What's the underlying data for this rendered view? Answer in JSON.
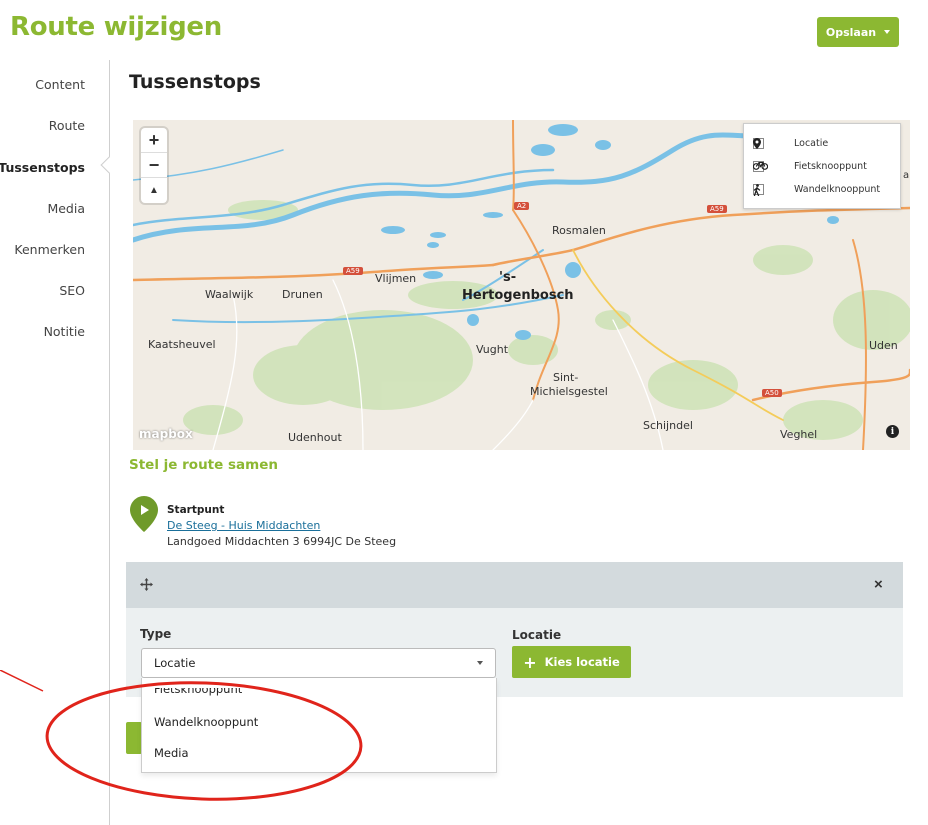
{
  "header": {
    "title": "Route wijzigen",
    "save_label": "Opslaan"
  },
  "sidebar": {
    "items": [
      {
        "label": "Content",
        "active": false
      },
      {
        "label": "Route",
        "active": false
      },
      {
        "label": "Tussenstops",
        "active": true
      },
      {
        "label": "Media",
        "active": false
      },
      {
        "label": "Kenmerken",
        "active": false
      },
      {
        "label": "SEO",
        "active": false
      },
      {
        "label": "Notitie",
        "active": false
      }
    ]
  },
  "main": {
    "section_title": "Tussenstops",
    "map": {
      "zoom_in": "+",
      "zoom_out": "−",
      "compass": "▲",
      "legend": [
        {
          "label": "Locatie",
          "icon": "location-pin-icon",
          "checked": false
        },
        {
          "label": "Fietsknooppunt",
          "icon": "bicycle-icon",
          "checked": false
        },
        {
          "label": "Wandelknooppunt",
          "icon": "walking-icon",
          "checked": false
        }
      ],
      "places": {
        "waalwijk": "Waalwijk",
        "drunen": "Drunen",
        "vlijmen": "Vlijmen",
        "hertogenbosch_1": "'s-",
        "hertogenbosch_2": "Hertogenbosch",
        "rosmalen": "Rosmalen",
        "kaatsheuvel": "Kaatsheuvel",
        "vught": "Vught",
        "sint_1": "Sint-",
        "sint_2": "Michielsgestel",
        "schijndel": "Schijndel",
        "veghel": "Veghel",
        "uden": "Uden",
        "udenhout": "Udenhout",
        "edge_ai": "ai"
      },
      "road_shields": {
        "a2": "A2",
        "a59_left": "A59",
        "a59_right": "A59",
        "a50": "A50"
      },
      "attribution": "mapbox",
      "info": "i",
      "colors": {
        "land": "#f1ece4",
        "water": "#7ac1e6",
        "green": "#cfe3b8",
        "road": "#f0a05a"
      }
    },
    "compose_title": "Stel je route samen",
    "start": {
      "label": "Startpunt",
      "name": "De Steeg - Huis Middachten",
      "address": "Landgoed Middachten 3 6994JC De Steeg"
    },
    "stop": {
      "type_label": "Type",
      "type_value": "Locatie",
      "location_label": "Locatie",
      "choose_label": "Kies locatie",
      "close": "×"
    },
    "dropdown_options": [
      "Fietsknooppunt",
      "Wandelknooppunt",
      "Media"
    ]
  },
  "colors": {
    "brand_green": "#8cb832",
    "annotation_red": "#e0241b",
    "link": "#1a6f9a"
  }
}
